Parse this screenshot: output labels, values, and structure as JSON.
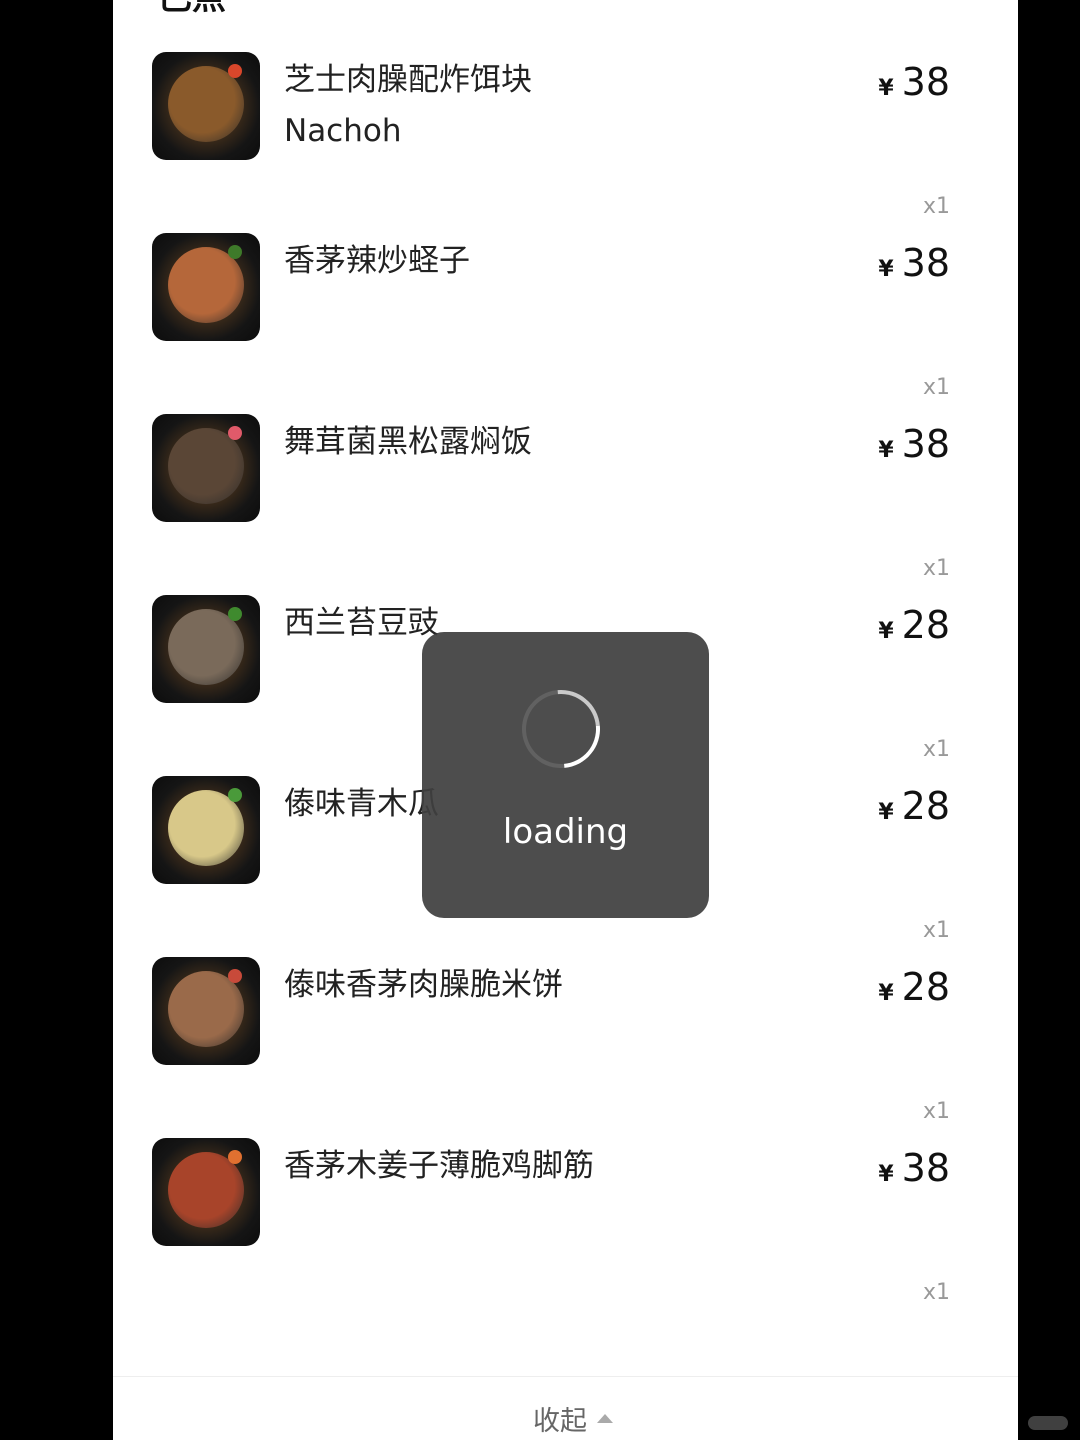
{
  "section": {
    "title": "已点"
  },
  "items": [
    {
      "name": "芝士肉臊配炸饵块Nachoh",
      "currency": "¥",
      "price": "38",
      "qty": "x1",
      "plate_color": "#8a5a2b",
      "garnish_color": "#d9472b"
    },
    {
      "name": "香茅辣炒蛏子",
      "currency": "¥",
      "price": "38",
      "qty": "x1",
      "plate_color": "#b5673a",
      "garnish_color": "#3e7a2a"
    },
    {
      "name": "舞茸菌黑松露焖饭",
      "currency": "¥",
      "price": "38",
      "qty": "x1",
      "plate_color": "#5a4636",
      "garnish_color": "#e05a6a"
    },
    {
      "name": "西兰苔豆豉",
      "currency": "¥",
      "price": "28",
      "qty": "x1",
      "plate_color": "#7a6a5a",
      "garnish_color": "#3f8a2e"
    },
    {
      "name": "傣味青木瓜",
      "currency": "¥",
      "price": "28",
      "qty": "x1",
      "plate_color": "#d8c889",
      "garnish_color": "#4a9a3a"
    },
    {
      "name": "傣味香茅肉臊脆米饼",
      "currency": "¥",
      "price": "28",
      "qty": "x1",
      "plate_color": "#9a6a4a",
      "garnish_color": "#c84a3a"
    },
    {
      "name": "香茅木姜子薄脆鸡脚筋",
      "currency": "¥",
      "price": "38",
      "qty": "x1",
      "plate_color": "#a8442a",
      "garnish_color": "#e07030"
    }
  ],
  "footer": {
    "collapse_label": "收起"
  },
  "toast": {
    "label": "loading"
  }
}
